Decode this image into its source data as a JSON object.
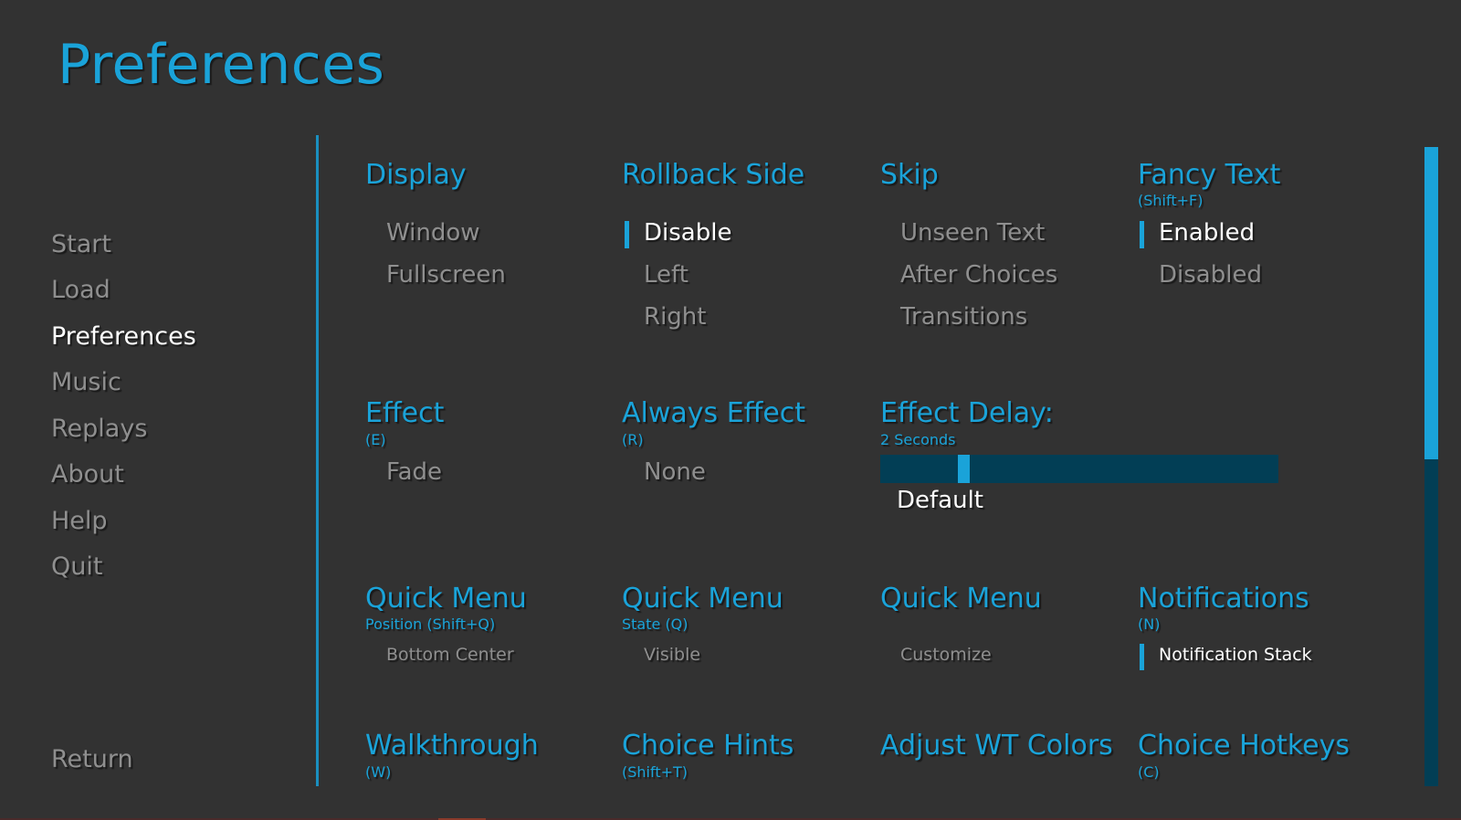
{
  "title": "Preferences",
  "nav": {
    "start": "Start",
    "load": "Load",
    "preferences": "Preferences",
    "music": "Music",
    "replays": "Replays",
    "about": "About",
    "help": "Help",
    "quit": "Quit",
    "return": "Return"
  },
  "display": {
    "title": "Display",
    "options": [
      "Window",
      "Fullscreen"
    ]
  },
  "rollback_side": {
    "title": "Rollback Side",
    "options": [
      "Disable",
      "Left",
      "Right"
    ],
    "selected": "Disable"
  },
  "skip": {
    "title": "Skip",
    "options": [
      "Unseen Text",
      "After Choices",
      "Transitions"
    ]
  },
  "fancy_text": {
    "title": "Fancy Text",
    "hotkey": "(Shift+F)",
    "options": [
      "Enabled",
      "Disabled"
    ],
    "selected": "Enabled"
  },
  "effect": {
    "title": "Effect",
    "hotkey": "(E)",
    "value": "Fade"
  },
  "always_effect": {
    "title": "Always Effect",
    "hotkey": "(R)",
    "value": "None"
  },
  "effect_delay": {
    "title": "Effect Delay:",
    "value_label": "2 Seconds",
    "slider_fraction": 0.2,
    "default_label": "Default"
  },
  "quick_menu_position": {
    "title": "Quick Menu",
    "sub": "Position (Shift+Q)",
    "value": "Bottom Center"
  },
  "quick_menu_state": {
    "title": "Quick Menu",
    "sub": "State (Q)",
    "value": "Visible"
  },
  "quick_menu_custom": {
    "title": "Quick Menu",
    "value": "Customize"
  },
  "notifications": {
    "title": "Notifications",
    "hotkey": "(N)",
    "value": "Notification Stack",
    "selected": true
  },
  "walkthrough": {
    "title": "Walkthrough",
    "hotkey": "(W)"
  },
  "choice_hints": {
    "title": "Choice Hints",
    "hotkey": "(Shift+T)"
  },
  "adjust_wt_colors": {
    "title": "Adjust WT Colors"
  },
  "choice_hotkeys": {
    "title": "Choice Hotkeys",
    "hotkey": "(C)"
  },
  "scrollbar": {
    "position_fraction": 0.0
  },
  "colors": {
    "background": "#323232",
    "accent": "#1aa3d9",
    "accent_dark": "#023e55",
    "idle_text": "#8f8f8f",
    "selected_text": "#ffffff"
  }
}
